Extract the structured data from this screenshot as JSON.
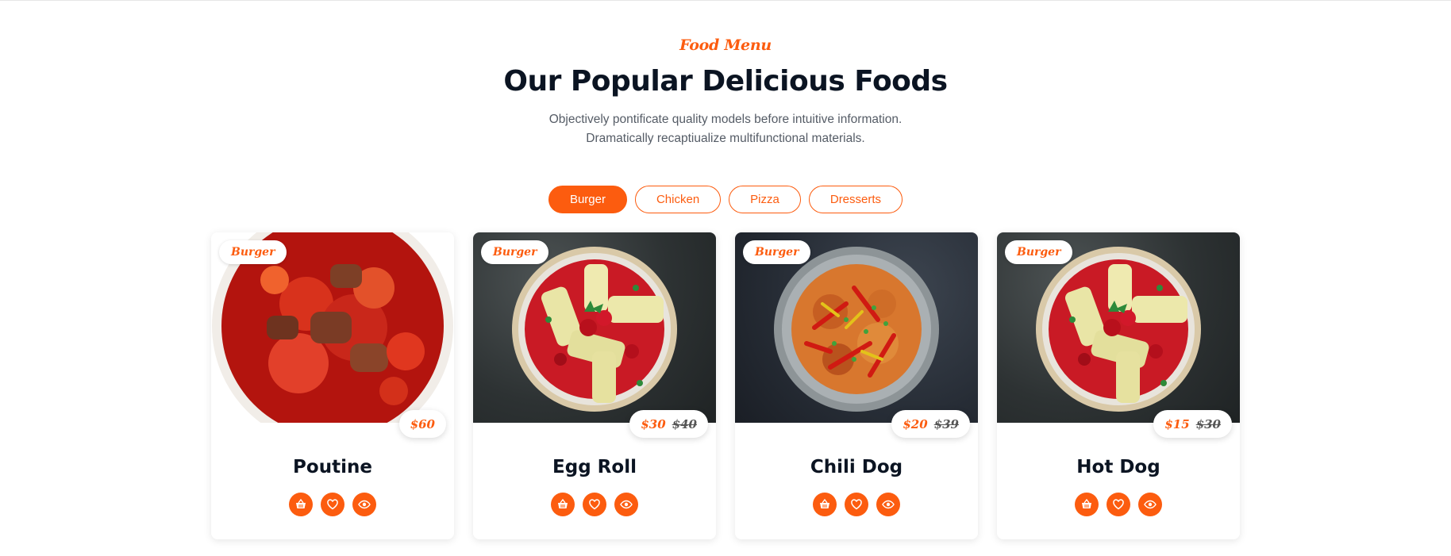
{
  "header": {
    "eyebrow": "Food Menu",
    "title": "Our Popular Delicious Foods",
    "subtitle_line1": "Objectively pontificate quality models before intuitive information.",
    "subtitle_line2": "Dramatically recaptiualize multifunctional materials."
  },
  "filters": [
    {
      "label": "Burger",
      "active": true
    },
    {
      "label": "Chicken",
      "active": false
    },
    {
      "label": "Pizza",
      "active": false
    },
    {
      "label": "Dresserts",
      "active": false
    }
  ],
  "cards": [
    {
      "tag": "Burger",
      "name": "Poutine",
      "price": "$60",
      "old_price": "",
      "image": "stew-bowl"
    },
    {
      "tag": "Burger",
      "name": "Egg Roll",
      "price": "$30",
      "old_price": "$40",
      "image": "pasta-plate"
    },
    {
      "tag": "Burger",
      "name": "Chili Dog",
      "price": "$20",
      "old_price": "$39",
      "image": "stir-fry-plate"
    },
    {
      "tag": "Burger",
      "name": "Hot Dog",
      "price": "$15",
      "old_price": "$30",
      "image": "pasta-plate"
    }
  ],
  "icons": {
    "cart": "basket-icon",
    "wishlist": "heart-icon",
    "view": "eye-icon"
  },
  "colors": {
    "accent": "#fc5c0f",
    "heading": "#0b1422",
    "body_text": "#555c66"
  }
}
